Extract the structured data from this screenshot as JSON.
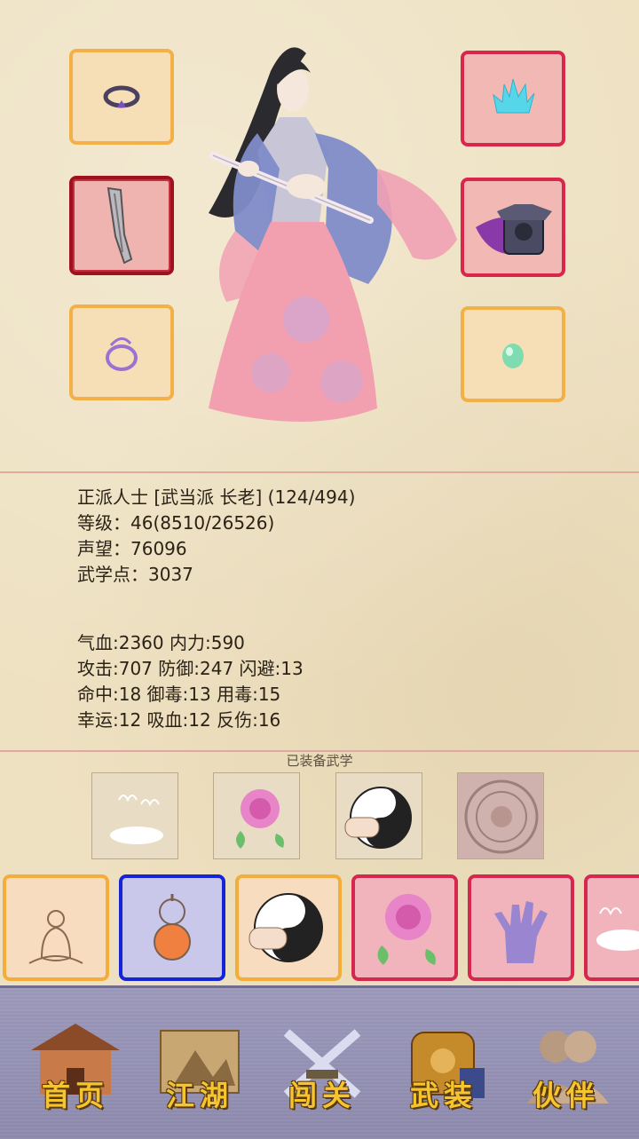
{
  "character": {
    "line1": "正派人士 [武当派 长老] (124/494)",
    "line2": "等级：46(8510/26526)",
    "line3": "声望：76096",
    "line4": "武学点：3037"
  },
  "stats": {
    "line1": "气血:2360  内力:590",
    "line2": "攻击:707  防御:247  闪避:13",
    "line3": "命中:18  御毒:13  用毒:15",
    "line4": "幸运:12  吸血:12  反伤:16"
  },
  "equipped_label": "已装备武学",
  "nav": {
    "home": "首页",
    "jianghu": "江湖",
    "chuangguan": "闯关",
    "wuzhuang": "武装",
    "huoban": "伙伴"
  },
  "colors": {
    "slot_orange": "#f3b046",
    "slot_red": "#d9274c",
    "slot_blue": "#1424d8",
    "nav_text": "#f5c42e"
  }
}
